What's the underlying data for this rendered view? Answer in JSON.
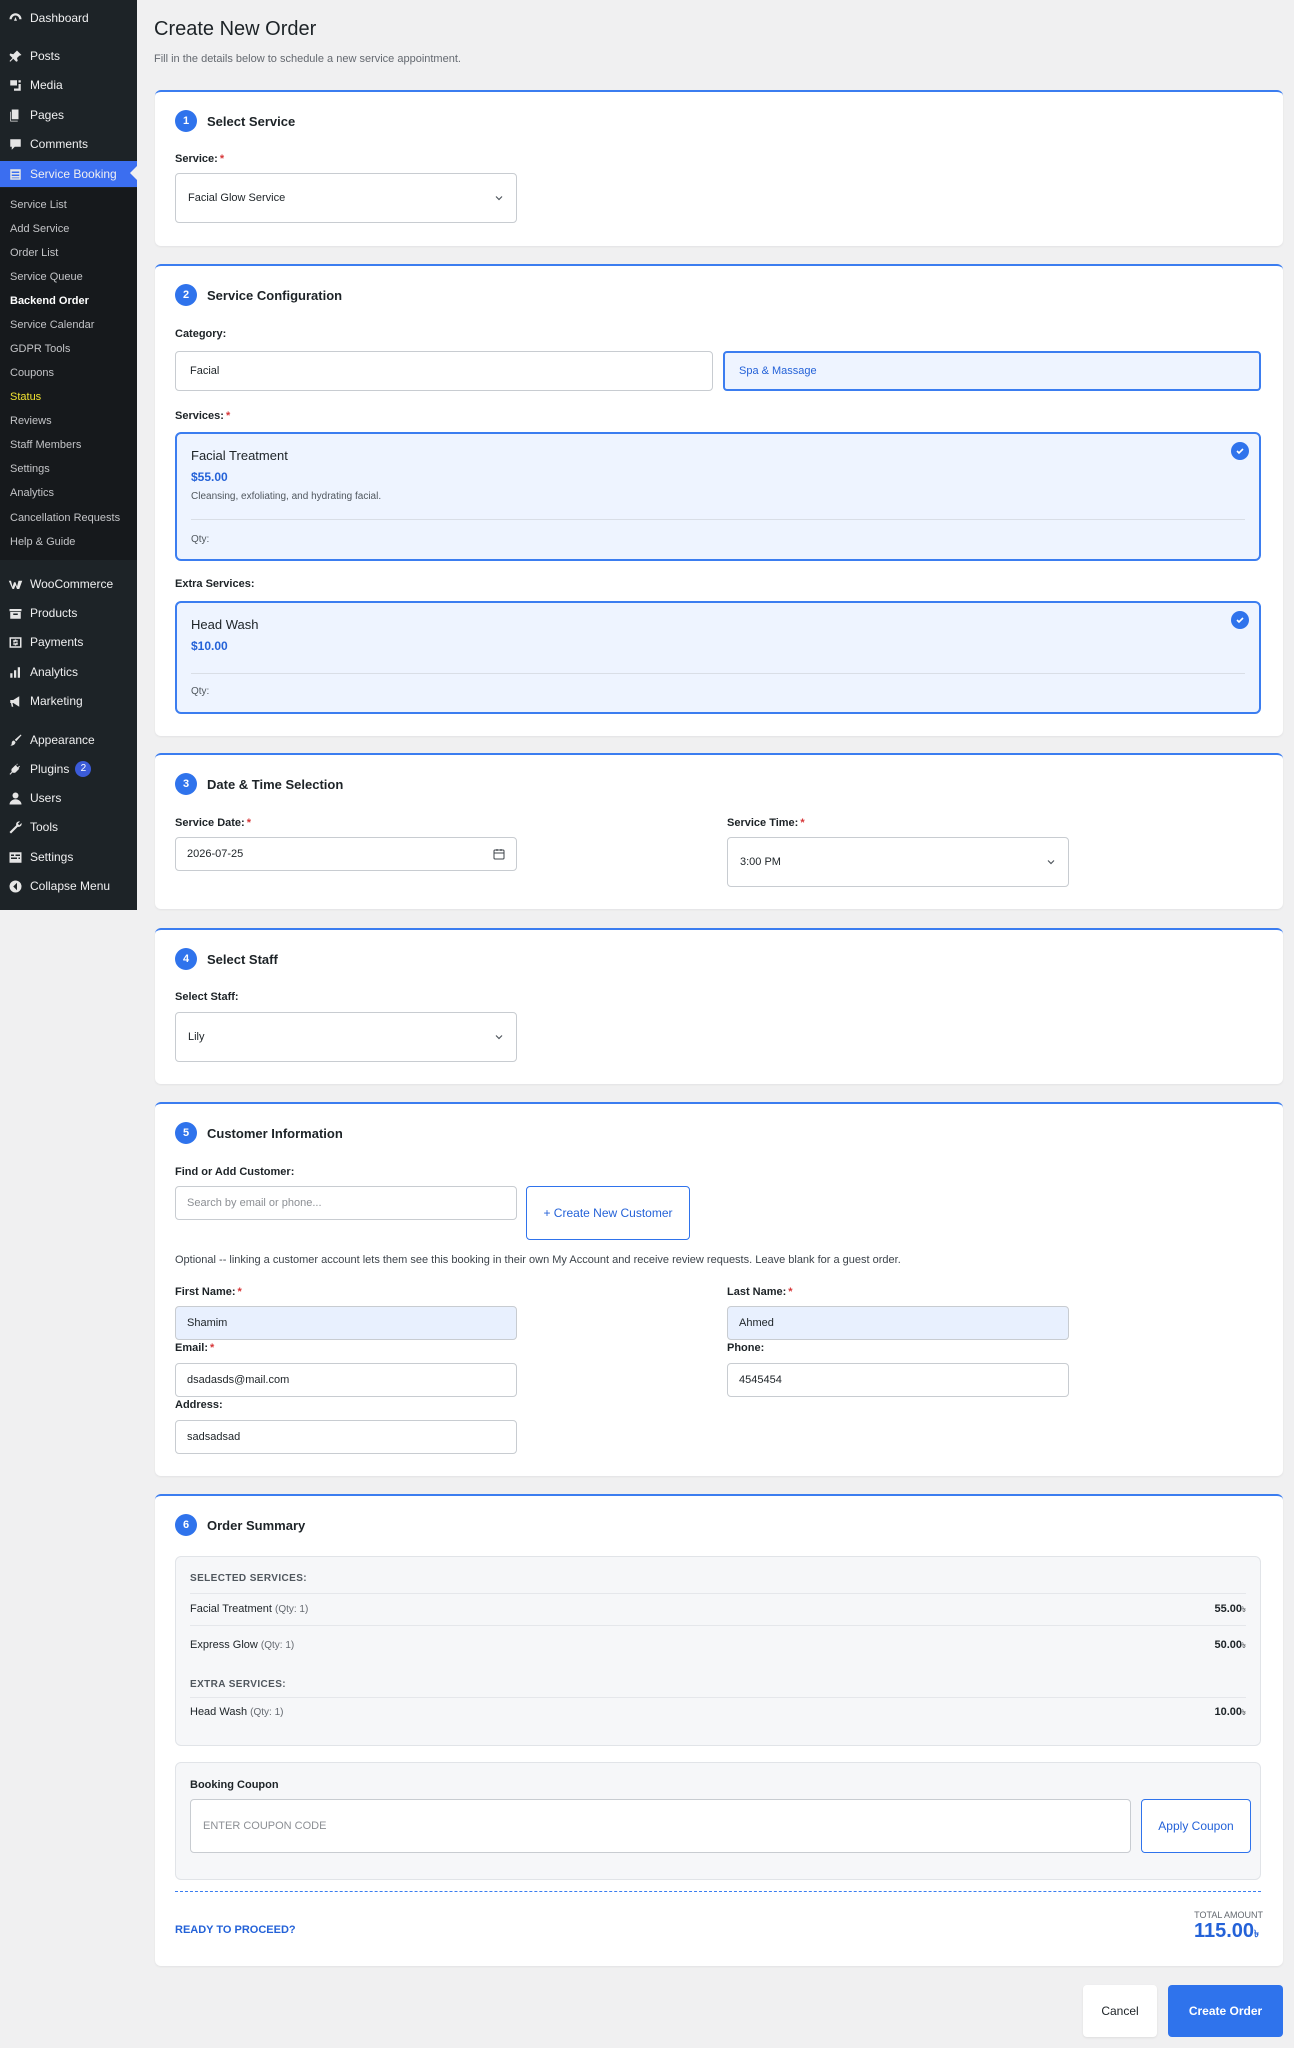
{
  "sidebar": {
    "top_items": [
      {
        "label": "Dashboard",
        "icon": "dashboard-icon"
      },
      {
        "label": "Posts",
        "icon": "pin-icon"
      },
      {
        "label": "Media",
        "icon": "media-icon"
      },
      {
        "label": "Pages",
        "icon": "pages-icon"
      },
      {
        "label": "Comments",
        "icon": "comment-icon"
      },
      {
        "label": "Service Booking",
        "icon": "list-icon"
      }
    ],
    "submenu": [
      "Service List",
      "Add Service",
      "Order List",
      "Service Queue",
      "Backend Order",
      "Service Calendar",
      "GDPR Tools",
      "Coupons",
      "Status",
      "Reviews",
      "Staff Members",
      "Settings",
      "Analytics",
      "Cancellation Requests",
      "Help & Guide"
    ],
    "bottom_items": [
      {
        "label": "WooCommerce",
        "icon": "woo-icon"
      },
      {
        "label": "Products",
        "icon": "archive-icon"
      },
      {
        "label": "Payments",
        "icon": "dollar-icon"
      },
      {
        "label": "Analytics",
        "icon": "bar-chart-icon"
      },
      {
        "label": "Marketing",
        "icon": "megaphone-icon"
      },
      {
        "label": "Appearance",
        "icon": "brush-icon"
      },
      {
        "label": "Plugins",
        "icon": "plugin-icon",
        "badge": "2"
      },
      {
        "label": "Users",
        "icon": "user-icon"
      },
      {
        "label": "Tools",
        "icon": "wrench-icon"
      },
      {
        "label": "Settings",
        "icon": "settings-icon"
      },
      {
        "label": "Collapse Menu",
        "icon": "collapse-icon"
      }
    ]
  },
  "page": {
    "title": "Create New Order",
    "subtitle": "Fill in the details below to schedule a new service appointment."
  },
  "step1": {
    "num": "1",
    "title": "Select Service",
    "service_label": "Service:",
    "service_value": "Facial Glow Service"
  },
  "step2": {
    "num": "2",
    "title": "Service Configuration",
    "category_label": "Category:",
    "categories": [
      "Facial",
      "Spa & Massage"
    ],
    "services_label": "Services:",
    "service": {
      "name": "Facial Treatment",
      "price": "$55.00",
      "desc": "Cleansing, exfoliating, and hydrating facial.",
      "qty": "Qty:"
    },
    "extra_label": "Extra Services:",
    "extra": {
      "name": "Head Wash",
      "price": "$10.00",
      "qty": "Qty:"
    }
  },
  "step3": {
    "num": "3",
    "title": "Date & Time Selection",
    "date_label": "Service Date:",
    "date_value": "2026-07-25",
    "time_label": "Service Time:",
    "time_value": "3:00 PM"
  },
  "step4": {
    "num": "4",
    "title": "Select Staff",
    "staff_label": "Select Staff:",
    "staff_value": "Lily"
  },
  "step5": {
    "num": "5",
    "title": "Customer Information",
    "find_label": "Find or Add Customer:",
    "search_placeholder": "Search by email or phone...",
    "create_btn": "+ Create New Customer",
    "note": "Optional -- linking a customer account lets them see this booking in their own My Account and receive review requests. Leave blank for a guest order.",
    "first_label": "First Name:",
    "first_value": "Shamim",
    "last_label": "Last Name:",
    "last_value": "Ahmed",
    "email_label": "Email:",
    "email_value": "dsadasds@mail.com",
    "phone_label": "Phone:",
    "phone_value": "4545454",
    "address_label": "Address:",
    "address_value": "sadsadsad"
  },
  "step6": {
    "num": "6",
    "title": "Order Summary",
    "selected_head": "SELECTED SERVICES:",
    "selected": [
      {
        "name": "Facial Treatment",
        "qty": "(Qty: 1)",
        "value": "55.00"
      },
      {
        "name": "Express Glow",
        "qty": "(Qty: 1)",
        "value": "50.00"
      }
    ],
    "extra_head": "EXTRA SERVICES:",
    "extras": [
      {
        "name": "Head Wash",
        "qty": "(Qty: 1)",
        "value": "10.00"
      }
    ],
    "currency": "৳",
    "coupon_label": "Booking Coupon",
    "coupon_placeholder": "ENTER COUPON CODE",
    "apply_btn": "Apply Coupon",
    "proceed": "READY TO PROCEED?",
    "total_label": "TOTAL AMOUNT",
    "total_value": "115.00"
  },
  "actions": {
    "cancel": "Cancel",
    "create": "Create Order"
  },
  "colors": {
    "accent": "#2f73ec",
    "sidebar_bg": "#1d2327",
    "active_menu": "#3b6ef0"
  }
}
